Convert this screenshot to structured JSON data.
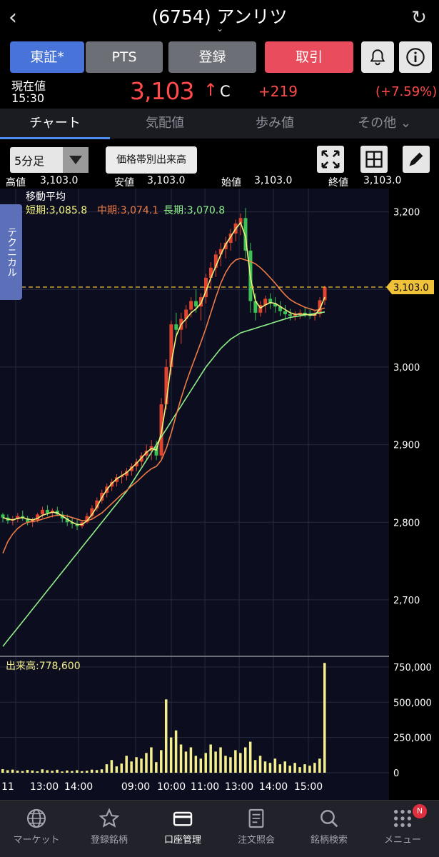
{
  "header": {
    "back_icon": "chevron-left-icon",
    "title": "(6754) アンリツ",
    "dropdown_icon": "chevron-down-icon",
    "reload_icon": "reload-icon"
  },
  "market_buttons": {
    "tosho": "東証*",
    "pts": "PTS",
    "register": "登録",
    "trade": "取引",
    "bell_icon": "bell-icon",
    "info_icon": "info-icon"
  },
  "quote": {
    "label_now": "現在値",
    "time": "15:30",
    "price": "3,103",
    "price_arrow": "↑",
    "price_flag": "C",
    "change": "+219",
    "change_pct": "(+7.59%)"
  },
  "tabs": [
    {
      "label": "チャート"
    },
    {
      "label": "気配値"
    },
    {
      "label": "歩み値"
    },
    {
      "label": "その他 ⌄"
    }
  ],
  "toolbar": {
    "interval": "5分足",
    "volume_by_price": "価格帯別出来高",
    "expand_icon": "expand-icon",
    "grid_icon": "grid-icon",
    "pen_icon": "pen-icon"
  },
  "ohlc": {
    "high_label": "高値",
    "high": "3,103.0",
    "low_label": "安値",
    "low": "3,103.0",
    "open_label": "始値",
    "open": "3,103.0",
    "close_label": "終値",
    "close": "3,103.0"
  },
  "technical_tab": "テクニカル",
  "chart_data": {
    "type": "line",
    "legend": {
      "title": "移動平均",
      "short": "短期:3,085.8",
      "mid": "中期:3,074.1",
      "long": "長期:3,070.8"
    },
    "price_axis": {
      "ticks": [
        "3,200",
        "3,100",
        "3,000",
        "2,900",
        "2,800",
        "2,700"
      ],
      "ylim": [
        2630,
        3230
      ]
    },
    "current_price_label": "3,103.0",
    "current_price": 3103,
    "volume_label": "出来高:778,600",
    "volume_axis": {
      "ticks": [
        "750,000",
        "500,000",
        "250,000",
        "0"
      ],
      "ylim": [
        0,
        800000
      ]
    },
    "x_ticks": [
      "11",
      "13:00",
      "14:00",
      "09:00",
      "10:00",
      "11:00",
      "13:00",
      "14:00",
      "15:00"
    ],
    "colors": {
      "up": "#e2442f",
      "down": "#3cc254",
      "short_ma": "#f3f27e",
      "mid_ma": "#ef7a45",
      "long_ma": "#8ef08a",
      "volume": "#f4ef8c",
      "price_line": "#f0c23a"
    },
    "candles": [
      [
        2810,
        2812,
        2800,
        2806
      ],
      [
        2806,
        2810,
        2798,
        2802
      ],
      [
        2802,
        2808,
        2796,
        2804
      ],
      [
        2804,
        2812,
        2800,
        2808
      ],
      [
        2808,
        2815,
        2802,
        2805
      ],
      [
        2805,
        2808,
        2796,
        2800
      ],
      [
        2800,
        2806,
        2794,
        2803
      ],
      [
        2803,
        2812,
        2800,
        2810
      ],
      [
        2810,
        2820,
        2806,
        2816
      ],
      [
        2816,
        2822,
        2808,
        2812
      ],
      [
        2812,
        2818,
        2806,
        2815
      ],
      [
        2815,
        2820,
        2808,
        2810
      ],
      [
        2810,
        2814,
        2800,
        2805
      ],
      [
        2805,
        2810,
        2795,
        2800
      ],
      [
        2800,
        2806,
        2792,
        2798
      ],
      [
        2798,
        2804,
        2790,
        2795
      ],
      [
        2795,
        2802,
        2792,
        2800
      ],
      [
        2800,
        2812,
        2798,
        2808
      ],
      [
        2808,
        2822,
        2804,
        2818
      ],
      [
        2818,
        2832,
        2814,
        2828
      ],
      [
        2828,
        2842,
        2824,
        2838
      ],
      [
        2838,
        2850,
        2832,
        2846
      ],
      [
        2846,
        2856,
        2840,
        2852
      ],
      [
        2852,
        2862,
        2846,
        2858
      ],
      [
        2858,
        2866,
        2850,
        2860
      ],
      [
        2860,
        2870,
        2854,
        2866
      ],
      [
        2866,
        2876,
        2860,
        2872
      ],
      [
        2872,
        2882,
        2866,
        2878
      ],
      [
        2878,
        2890,
        2872,
        2886
      ],
      [
        2886,
        2900,
        2880,
        2892
      ],
      [
        2892,
        2906,
        2880,
        2898
      ],
      [
        2898,
        2905,
        2880,
        2886
      ],
      [
        2886,
        2960,
        2880,
        2952
      ],
      [
        2952,
        3010,
        2945,
        3000
      ],
      [
        3000,
        3060,
        2990,
        3055
      ],
      [
        3055,
        3070,
        3040,
        3048
      ],
      [
        3048,
        3070,
        3030,
        3062
      ],
      [
        3062,
        3080,
        3050,
        3074
      ],
      [
        3074,
        3090,
        3064,
        3085
      ],
      [
        3085,
        3100,
        3070,
        3078
      ],
      [
        3078,
        3095,
        3060,
        3090
      ],
      [
        3090,
        3120,
        3082,
        3115
      ],
      [
        3115,
        3135,
        3100,
        3128
      ],
      [
        3128,
        3150,
        3116,
        3145
      ],
      [
        3145,
        3160,
        3130,
        3152
      ],
      [
        3152,
        3168,
        3140,
        3160
      ],
      [
        3160,
        3178,
        3150,
        3172
      ],
      [
        3172,
        3190,
        3162,
        3185
      ],
      [
        3185,
        3198,
        3170,
        3192
      ],
      [
        3192,
        3205,
        3140,
        3150
      ],
      [
        3150,
        3160,
        3070,
        3085
      ],
      [
        3085,
        3095,
        3060,
        3070
      ],
      [
        3070,
        3085,
        3065,
        3080
      ],
      [
        3080,
        3092,
        3070,
        3088
      ],
      [
        3088,
        3095,
        3075,
        3082
      ],
      [
        3082,
        3090,
        3070,
        3078
      ],
      [
        3078,
        3085,
        3066,
        3072
      ],
      [
        3072,
        3080,
        3062,
        3068
      ],
      [
        3068,
        3075,
        3060,
        3066
      ],
      [
        3066,
        3072,
        3060,
        3068
      ],
      [
        3068,
        3074,
        3062,
        3070
      ],
      [
        3070,
        3076,
        3064,
        3068
      ],
      [
        3068,
        3074,
        3062,
        3066
      ],
      [
        3066,
        3072,
        3060,
        3068
      ],
      [
        3068,
        3090,
        3064,
        3086
      ],
      [
        3086,
        3105,
        3080,
        3103
      ]
    ],
    "short_ma": [
      2806,
      2804,
      2803,
      2805,
      2806,
      2804,
      2803,
      2805,
      2809,
      2811,
      2813,
      2812,
      2808,
      2804,
      2800,
      2797,
      2797,
      2802,
      2810,
      2820,
      2832,
      2842,
      2850,
      2856,
      2860,
      2864,
      2870,
      2876,
      2883,
      2890,
      2895,
      2893,
      2915,
      2955,
      3005,
      3040,
      3055,
      3062,
      3070,
      3075,
      3082,
      3098,
      3115,
      3130,
      3145,
      3158,
      3168,
      3178,
      3186,
      3168,
      3115,
      3085,
      3076,
      3080,
      3083,
      3082,
      3078,
      3074,
      3070,
      3068,
      3068,
      3068,
      3067,
      3067,
      3075,
      3090
    ],
    "mid_ma": [
      2760,
      2775,
      2785,
      2792,
      2797,
      2800,
      2801,
      2802,
      2804,
      2806,
      2808,
      2809,
      2809,
      2808,
      2806,
      2804,
      2802,
      2802,
      2804,
      2808,
      2812,
      2818,
      2824,
      2830,
      2836,
      2841,
      2847,
      2852,
      2858,
      2864,
      2869,
      2872,
      2880,
      2895,
      2915,
      2938,
      2960,
      2980,
      2998,
      3015,
      3032,
      3050,
      3070,
      3090,
      3108,
      3122,
      3132,
      3138,
      3140,
      3138,
      3136,
      3133,
      3128,
      3122,
      3115,
      3108,
      3100,
      3093,
      3087,
      3083,
      3080,
      3077,
      3075,
      3073,
      3074,
      3076
    ],
    "long_ma": [
      2640,
      2648,
      2656,
      2664,
      2672,
      2680,
      2688,
      2696,
      2704,
      2712,
      2720,
      2728,
      2736,
      2744,
      2752,
      2760,
      2768,
      2776,
      2784,
      2792,
      2800,
      2808,
      2816,
      2824,
      2832,
      2840,
      2850,
      2860,
      2870,
      2880,
      2890,
      2900,
      2910,
      2920,
      2930,
      2940,
      2950,
      2960,
      2970,
      2980,
      2990,
      3000,
      3008,
      3016,
      3024,
      3030,
      3036,
      3040,
      3044,
      3046,
      3048,
      3050,
      3052,
      3054,
      3056,
      3058,
      3060,
      3062,
      3064,
      3065,
      3066,
      3067,
      3068,
      3069,
      3070,
      3071
    ],
    "volume": [
      25000,
      18000,
      22000,
      15000,
      12000,
      20000,
      16000,
      10000,
      24000,
      18000,
      14000,
      21000,
      9000,
      16000,
      12000,
      18000,
      11000,
      14000,
      22000,
      19000,
      24000,
      60000,
      90000,
      45000,
      65000,
      120000,
      80000,
      110000,
      100000,
      140000,
      180000,
      75000,
      160000,
      520000,
      250000,
      300000,
      200000,
      150000,
      180000,
      120000,
      100000,
      140000,
      200000,
      150000,
      180000,
      120000,
      110000,
      160000,
      140000,
      180000,
      220000,
      90000,
      120000,
      80000,
      70000,
      100000,
      60000,
      80000,
      50000,
      70000,
      40000,
      60000,
      50000,
      70000,
      100000,
      778600
    ]
  },
  "bottom_nav": [
    {
      "label": "マーケット",
      "icon": "globe-icon"
    },
    {
      "label": "登録銘柄",
      "icon": "star-icon"
    },
    {
      "label": "口座管理",
      "icon": "card-icon"
    },
    {
      "label": "注文照会",
      "icon": "document-icon"
    },
    {
      "label": "銘柄検索",
      "icon": "search-icon"
    },
    {
      "label": "メニュー",
      "icon": "menu-icon"
    }
  ],
  "nav_badge": "N"
}
